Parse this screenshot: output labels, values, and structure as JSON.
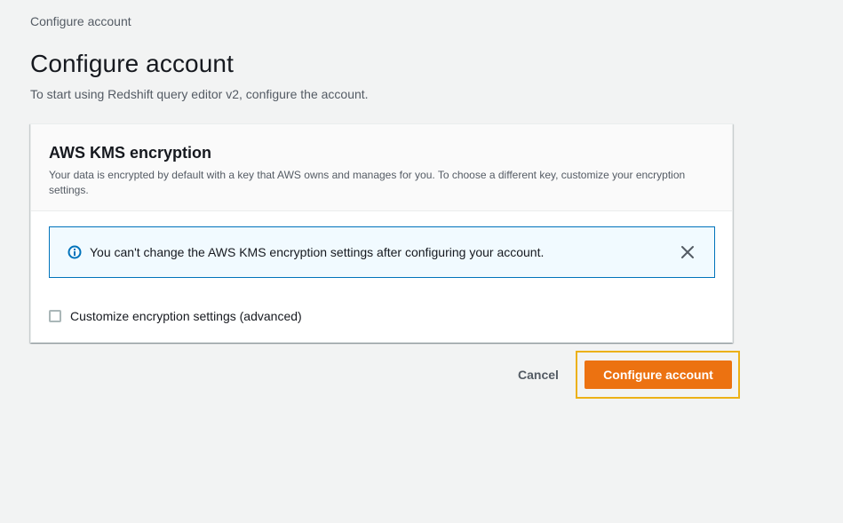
{
  "breadcrumb": "Configure account",
  "page": {
    "title": "Configure account",
    "description": "To start using Redshift query editor v2, configure the account."
  },
  "panel": {
    "title": "AWS KMS encryption",
    "description": "Your data is encrypted by default with a key that AWS owns and manages for you. To choose a different key, customize your encryption settings."
  },
  "alert": {
    "icon": "info-icon",
    "message": "You can't change the AWS KMS encryption settings after configuring your account.",
    "close_icon": "close-icon"
  },
  "checkbox": {
    "label": "Customize encryption settings (advanced)",
    "checked": false
  },
  "actions": {
    "cancel_label": "Cancel",
    "primary_label": "Configure account"
  },
  "colors": {
    "primary": "#ec7211",
    "focus_ring": "#ecb116",
    "info": "#0073bb",
    "info_bg": "#f1faff"
  }
}
